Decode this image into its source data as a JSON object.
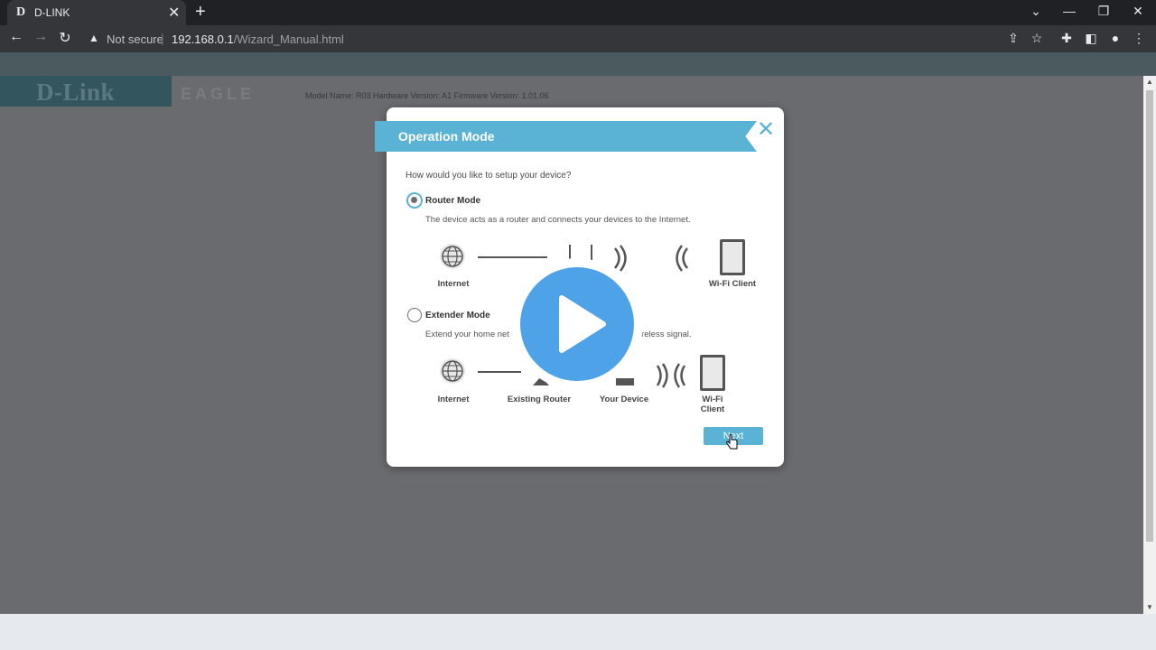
{
  "browser": {
    "tab_favicon": "D",
    "tab_title": "D-LINK",
    "tab_close": "✕",
    "new_tab": "+",
    "security_text": "Not secure",
    "url_host": "192.168.0.1",
    "url_path": "/Wizard_Manual.html",
    "separator": "|"
  },
  "page": {
    "logo_text": "D-Link",
    "product_name": "EAGLE",
    "model_info": "Model Name: R03 Hardware Version: A1 Firmware Version: 1.01.06"
  },
  "modal": {
    "title": "Operation Mode",
    "close": "✕",
    "question": "How would you like to setup your device?",
    "router_mode": {
      "label": "Router Mode",
      "selected": true,
      "description": "The device acts as a router and connects your devices to the Internet.",
      "diagram": [
        "Internet",
        "Wi-Fi Client"
      ]
    },
    "extender_mode": {
      "label": "Extender Mode",
      "selected": false,
      "description_left": "Extend your home net",
      "description_right": "ireless signal.",
      "diagram": [
        "Internet",
        "Existing Router",
        "Your Device",
        "Wi-Fi Client"
      ]
    },
    "next_label": "Next"
  },
  "colors": {
    "accent": "#5ab3d4",
    "play_button": "#4ea3e8"
  }
}
